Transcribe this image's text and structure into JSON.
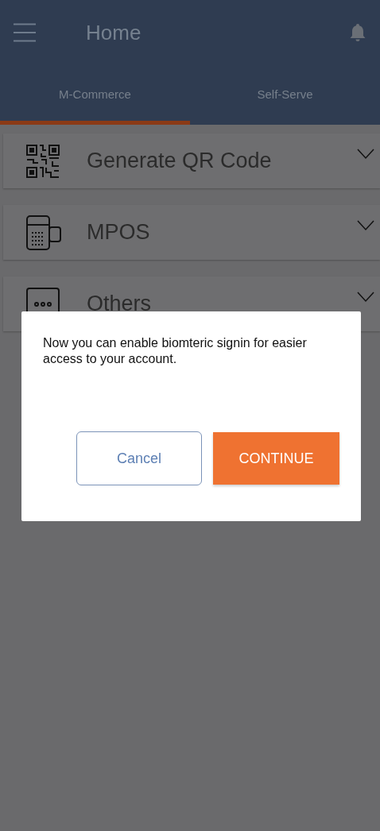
{
  "header": {
    "title": "Home"
  },
  "tabs": [
    {
      "label": "M-Commerce",
      "selected": true
    },
    {
      "label": "Self-Serve",
      "selected": false
    }
  ],
  "sections": [
    {
      "label": "Generate QR Code",
      "expanded": false
    },
    {
      "label": "MPOS",
      "expanded": false
    },
    {
      "label": "Others",
      "expanded": false
    }
  ],
  "dialog": {
    "message": "Now you can enable biomteric signin for easier access to your account.",
    "buttons": [
      {
        "label": "Cancel",
        "kind": "secondary"
      },
      {
        "label": "CONTINUE",
        "kind": "primary"
      }
    ]
  }
}
